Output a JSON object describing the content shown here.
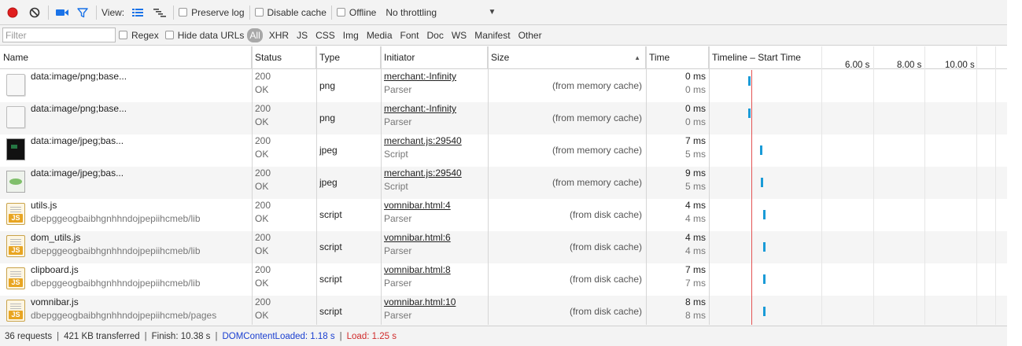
{
  "toolbar": {
    "view_label": "View:",
    "preserve_log_label": "Preserve log",
    "disable_cache_label": "Disable cache",
    "offline_label": "Offline",
    "throttling_value": "No throttling",
    "colors": {
      "record": "#e01e1e",
      "accent": "#1a73e8"
    }
  },
  "filterbar": {
    "filter_placeholder": "Filter",
    "regex_label": "Regex",
    "hide_data_urls_label": "Hide data URLs",
    "types": [
      "All",
      "XHR",
      "JS",
      "CSS",
      "Img",
      "Media",
      "Font",
      "Doc",
      "WS",
      "Manifest",
      "Other"
    ]
  },
  "columns": {
    "name": "Name",
    "status": "Status",
    "type": "Type",
    "initiator": "Initiator",
    "size": "Size",
    "time": "Time",
    "timeline": "Timeline – Start Time",
    "ticks": [
      "6.00 s",
      "8.00 s",
      "10.00 s"
    ]
  },
  "rows": [
    {
      "name": "data:image/png;base...",
      "path": "",
      "status": "200",
      "status_text": "OK",
      "type": "png",
      "initiator": "merchant:-Infinity",
      "initiator_type": "Parser",
      "size": "(from memory cache)",
      "time": "0 ms",
      "latency": "0 ms",
      "icon": "image-doc-icon"
    },
    {
      "name": "data:image/png;base...",
      "path": "",
      "status": "200",
      "status_text": "OK",
      "type": "png",
      "initiator": "merchant:-Infinity",
      "initiator_type": "Parser",
      "size": "(from memory cache)",
      "time": "0 ms",
      "latency": "0 ms",
      "icon": "image-doc-icon"
    },
    {
      "name": "data:image/jpeg;bas...",
      "path": "",
      "status": "200",
      "status_text": "OK",
      "type": "jpeg",
      "initiator": "merchant.js:29540",
      "initiator_type": "Script",
      "size": "(from memory cache)",
      "time": "7 ms",
      "latency": "5 ms",
      "icon": "image-thumbnail-icon"
    },
    {
      "name": "data:image/jpeg;bas...",
      "path": "",
      "status": "200",
      "status_text": "OK",
      "type": "jpeg",
      "initiator": "merchant.js:29540",
      "initiator_type": "Script",
      "size": "(from memory cache)",
      "time": "9 ms",
      "latency": "5 ms",
      "icon": "image-thumbnail-icon"
    },
    {
      "name": "utils.js",
      "path": "dbepggeogbaibhgnhhndojpepiihcmeb/lib",
      "status": "200",
      "status_text": "OK",
      "type": "script",
      "initiator": "vomnibar.html:4",
      "initiator_type": "Parser",
      "size": "(from disk cache)",
      "time": "4 ms",
      "latency": "4 ms",
      "icon": "js-file-icon"
    },
    {
      "name": "dom_utils.js",
      "path": "dbepggeogbaibhgnhhndojpepiihcmeb/lib",
      "status": "200",
      "status_text": "OK",
      "type": "script",
      "initiator": "vomnibar.html:6",
      "initiator_type": "Parser",
      "size": "(from disk cache)",
      "time": "4 ms",
      "latency": "4 ms",
      "icon": "js-file-icon"
    },
    {
      "name": "clipboard.js",
      "path": "dbepggeogbaibhgnhhndojpepiihcmeb/lib",
      "status": "200",
      "status_text": "OK",
      "type": "script",
      "initiator": "vomnibar.html:8",
      "initiator_type": "Parser",
      "size": "(from disk cache)",
      "time": "7 ms",
      "latency": "7 ms",
      "icon": "js-file-icon"
    },
    {
      "name": "vomnibar.js",
      "path": "dbepggeogbaibhgnhhndojpepiihcmeb/pages",
      "status": "200",
      "status_text": "OK",
      "type": "script",
      "initiator": "vomnibar.html:10",
      "initiator_type": "Parser",
      "size": "(from disk cache)",
      "time": "8 ms",
      "latency": "8 ms",
      "icon": "js-file-icon"
    }
  ],
  "statusbar": {
    "requests": "36 requests",
    "transferred": "421 KB transferred",
    "finish": "Finish: 10.38 s",
    "dom_content_loaded": "DOMContentLoaded: 1.18 s",
    "load": "Load: 1.25 s"
  }
}
